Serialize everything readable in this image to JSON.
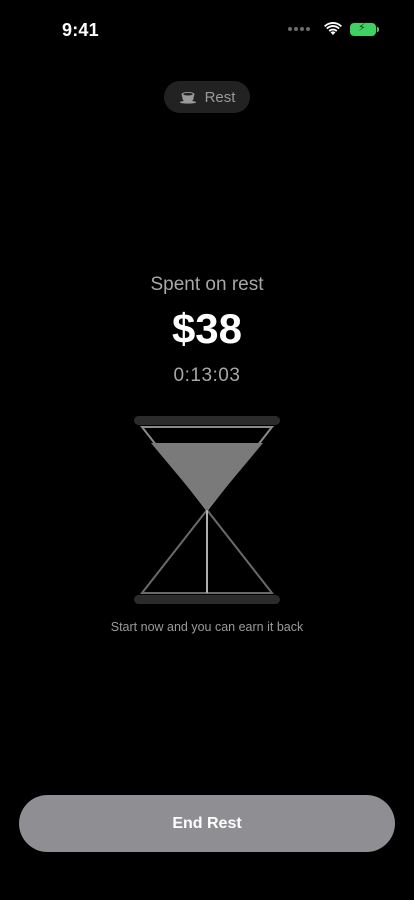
{
  "status_bar": {
    "time": "9:41",
    "icons": [
      "cellular-dots-icon",
      "wifi-icon",
      "battery-charging-icon"
    ],
    "battery_color": "#3fd163"
  },
  "mode": {
    "icon": "coffee-cup-icon",
    "label": "Rest"
  },
  "summary": {
    "title": "Spent on rest",
    "amount": "$38",
    "elapsed": "0:13:03"
  },
  "hourglass": {
    "icon": "hourglass-icon",
    "caption": "Start now and you can earn it back"
  },
  "actions": {
    "end_label": "End Rest",
    "button_color": "#8e8e93"
  }
}
